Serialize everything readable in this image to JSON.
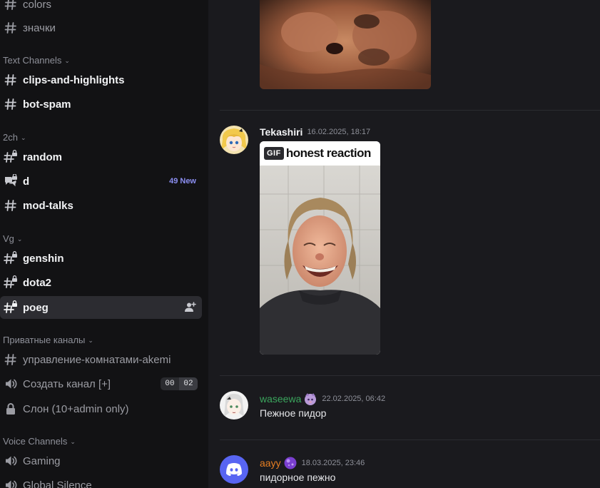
{
  "sidebar": {
    "channels_top": [
      {
        "label": "colors",
        "icon": "hash-icon"
      },
      {
        "label": "значки",
        "icon": "hash-icon"
      }
    ],
    "categories": [
      {
        "name": "Text Channels",
        "channels": [
          {
            "label": "clips-and-highlights",
            "icon": "hash-icon"
          },
          {
            "label": "bot-spam",
            "icon": "hash-icon"
          }
        ]
      },
      {
        "name": "2ch",
        "channels": [
          {
            "label": "random",
            "icon": "locked-hash-icon"
          },
          {
            "label": "d",
            "icon": "locked-forum-icon",
            "badge": "49 New"
          },
          {
            "label": "mod-talks",
            "icon": "hash-icon"
          }
        ]
      },
      {
        "name": "Vg",
        "channels": [
          {
            "label": "genshin",
            "icon": "locked-hash-icon"
          },
          {
            "label": "dota2",
            "icon": "locked-hash-icon"
          },
          {
            "label": "poeg",
            "icon": "locked-hash-icon",
            "active": true
          }
        ]
      },
      {
        "name": "Приватные каналы",
        "channels": [
          {
            "label": "управление-комнатами-akemi",
            "icon": "hash-icon"
          },
          {
            "label": "Создать канал [+]",
            "icon": "speaker-icon",
            "counter": [
              "00",
              "02"
            ]
          },
          {
            "label": "Слон (10+admin only)",
            "icon": "lock-icon"
          }
        ]
      },
      {
        "name": "Voice Channels",
        "channels": [
          {
            "label": "Gaming",
            "icon": "speaker-icon"
          },
          {
            "label": "Global Silence",
            "icon": "speaker-icon"
          }
        ]
      }
    ]
  },
  "messages": [
    {
      "author": "Tekashiri",
      "timestamp": "16.02.2025, 18:17",
      "gif": {
        "badge": "GIF",
        "caption": "honest reaction"
      }
    },
    {
      "author": "waseewa",
      "timestamp": "22.02.2025, 06:42",
      "text": "Пежное пидор"
    },
    {
      "author": "aayy",
      "timestamp": "18.03.2025, 23:46",
      "text": "пидорное пежно"
    }
  ],
  "colors": {
    "sidebar_bg": "#121214",
    "main_bg": "#1a1a1e",
    "active_channel_bg": "#2c2c31",
    "new_badge": "#8c8ff2",
    "author_green": "#3ba55d",
    "author_orange": "#e67e22",
    "discord_blurple": "#5865f2"
  }
}
